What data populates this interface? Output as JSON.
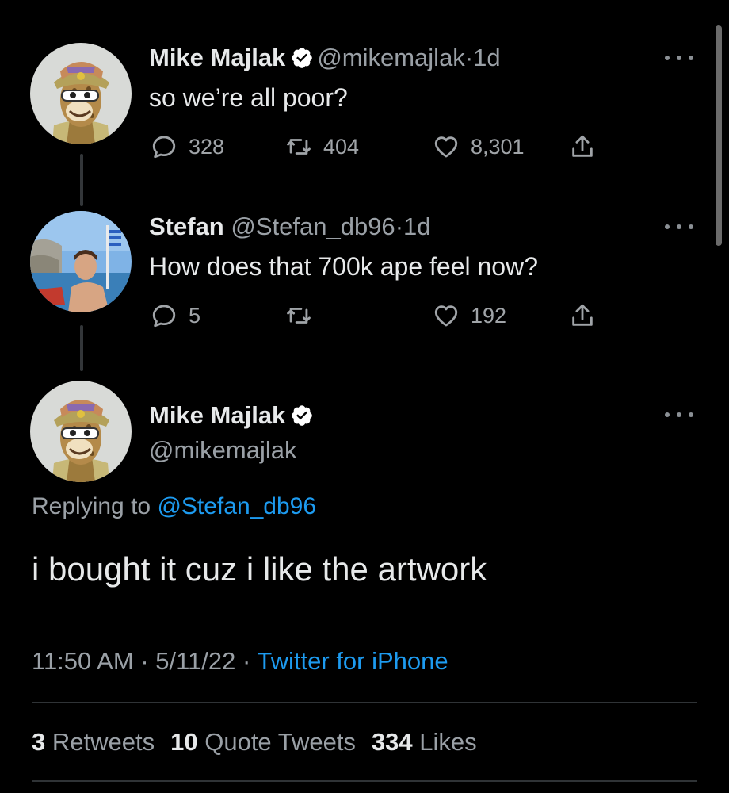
{
  "tweets": [
    {
      "name": "Mike Majlak",
      "handle": "@mikemajlak",
      "time": "1d",
      "text": "so we’re all poor?",
      "replies": "328",
      "retweets": "404",
      "likes": "8,301"
    },
    {
      "name": "Stefan",
      "handle": "@Stefan_db96",
      "time": "1d",
      "text": "How does that 700k ape feel now?",
      "replies": "5",
      "retweets": "",
      "likes": "192"
    }
  ],
  "focused": {
    "name": "Mike Majlak",
    "handle": "@mikemajlak",
    "replying_prefix": "Replying to",
    "replying_to": "@Stefan_db96",
    "text": "i bought it cuz i like the artwork",
    "time": "11:50 AM",
    "date": "5/11/22",
    "source": "Twitter for iPhone",
    "retweets_count": "3",
    "retweets_label": "Retweets",
    "quotes_count": "10",
    "quotes_label": "Quote Tweets",
    "likes_count": "334",
    "likes_label": "Likes"
  },
  "separator": "·",
  "colors": {
    "background": "#000000",
    "link": "#1d9bf0",
    "secondary_text": "#9aa0a6",
    "verified_badge": "#ffffff"
  }
}
